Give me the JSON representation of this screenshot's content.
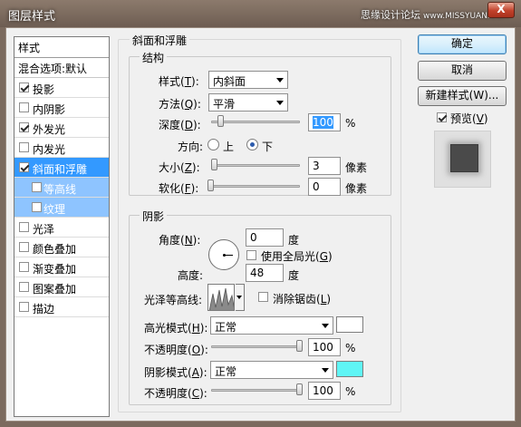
{
  "window": {
    "title": "图层样式",
    "watermark": "思缘设计论坛",
    "watermark_site": "www.MISSYUAN.COM",
    "close_glyph": "X"
  },
  "sidebar": {
    "header": "样式",
    "blend_options": "混合选项:默认",
    "items": [
      {
        "label": "投影",
        "checked": true
      },
      {
        "label": "内阴影",
        "checked": false
      },
      {
        "label": "外发光",
        "checked": true
      },
      {
        "label": "内发光",
        "checked": false
      },
      {
        "label": "斜面和浮雕",
        "checked": true,
        "selected": true
      },
      {
        "label": "等高线",
        "checked": false,
        "sub": true
      },
      {
        "label": "纹理",
        "checked": false,
        "sub": true
      },
      {
        "label": "光泽",
        "checked": false
      },
      {
        "label": "颜色叠加",
        "checked": false
      },
      {
        "label": "渐变叠加",
        "checked": false
      },
      {
        "label": "图案叠加",
        "checked": false
      },
      {
        "label": "描边",
        "checked": false
      }
    ]
  },
  "bevel": {
    "section_title": "斜面和浮雕",
    "structure": {
      "title": "结构",
      "style_label": "样式(",
      "style_key": "T",
      "style_value": "内斜面",
      "technique_label": "方法(",
      "technique_key": "Q",
      "technique_value": "平滑",
      "depth_label": "深度(",
      "depth_key": "D",
      "depth_value": "100",
      "depth_unit": "%",
      "depth_fraction": 0.1,
      "direction_label": "方向:",
      "direction_up": "上",
      "direction_down": "下",
      "size_label": "大小(",
      "size_key": "Z",
      "size_value": "3",
      "size_unit": "像素",
      "soften_label": "软化(",
      "soften_key": "F",
      "soften_value": "0",
      "soften_unit": "像素"
    },
    "shading": {
      "title": "阴影",
      "angle_label": "角度(",
      "angle_key": "N",
      "angle_value": "0",
      "angle_unit": "度",
      "global_light_label": "使用全局光(",
      "global_light_key": "G",
      "global_light_checked": false,
      "altitude_label": "高度:",
      "altitude_value": "48",
      "altitude_unit": "度",
      "gloss_contour_label": "光泽等高线:",
      "antialias_label": "消除锯齿(",
      "antialias_key": "L",
      "antialias_checked": false,
      "highlight_mode_label": "高光模式(",
      "highlight_mode_key": "H",
      "highlight_mode_value": "正常",
      "highlight_color": "#ffffff",
      "highlight_opacity_label": "不透明度(",
      "highlight_opacity_key": "O",
      "highlight_opacity_value": "100",
      "highlight_opacity_unit": "%",
      "shadow_mode_label": "阴影模式(",
      "shadow_mode_key": "A",
      "shadow_mode_value": "正常",
      "shadow_color": "#5ff5f5",
      "shadow_opacity_label": "不透明度(",
      "shadow_opacity_key": "C",
      "shadow_opacity_value": "100",
      "shadow_opacity_unit": "%"
    }
  },
  "buttons": {
    "ok": "确定",
    "cancel": "取消",
    "new_style": "新建样式(W)...",
    "preview_label": "预览(",
    "preview_key": "V",
    "preview_checked": true
  },
  "close_paren": ")",
  "colon_paren": "):"
}
